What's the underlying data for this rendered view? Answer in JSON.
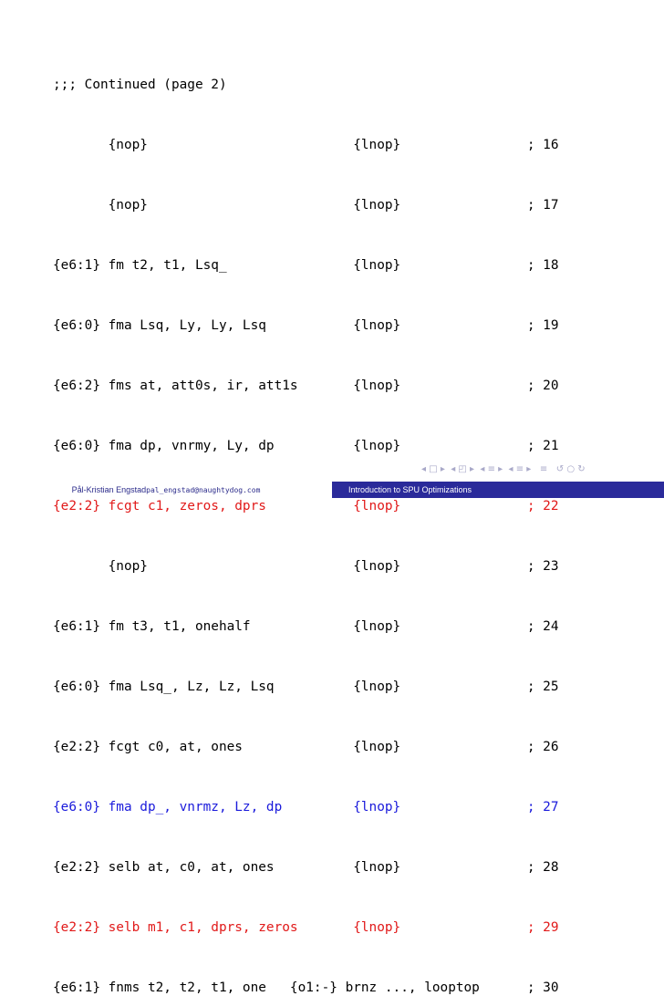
{
  "code_lines": [
    {
      "text": ";;; Continued (page 2)",
      "color": "black"
    },
    {
      "text": "       {nop}                          {lnop}                ; 16",
      "color": "black"
    },
    {
      "text": "       {nop}                          {lnop}                ; 17",
      "color": "black"
    },
    {
      "text": "{e6:1} fm t2, t1, Lsq_                {lnop}                ; 18",
      "color": "black"
    },
    {
      "text": "{e6:0} fma Lsq, Ly, Ly, Lsq           {lnop}                ; 19",
      "color": "black"
    },
    {
      "text": "{e6:2} fms at, att0s, ir, att1s       {lnop}                ; 20",
      "color": "black"
    },
    {
      "text": "{e6:0} fma dp, vnrmy, Ly, dp          {lnop}                ; 21",
      "color": "black"
    },
    {
      "text": "{e2:2} fcgt c1, zeros, dprs           {lnop}                ; 22",
      "color": "red"
    },
    {
      "text": "       {nop}                          {lnop}                ; 23",
      "color": "black"
    },
    {
      "text": "{e6:1} fm t3, t1, onehalf             {lnop}                ; 24",
      "color": "black"
    },
    {
      "text": "{e6:0} fma Lsq_, Lz, Lz, Lsq          {lnop}                ; 25",
      "color": "black"
    },
    {
      "text": "{e2:2} fcgt c0, at, ones              {lnop}                ; 26",
      "color": "black"
    },
    {
      "text": "{e6:0} fma dp_, vnrmz, Lz, dp         {lnop}                ; 27",
      "color": "blue"
    },
    {
      "text": "{e2:2} selb at, c0, at, ones          {lnop}                ; 28",
      "color": "black"
    },
    {
      "text": "{e2:2} selb m1, c1, dprs, zeros       {lnop}                ; 29",
      "color": "red"
    },
    {
      "text": "{e6:1} fnms t2, t2, t1, one   {o1:-} brnz ..., looptop      ; 30",
      "color": "black"
    }
  ],
  "footer": {
    "author": "Pål-Kristian Engstad",
    "email": "pal_engstad@naughtydog.com",
    "title": "Introduction to SPU Optimizations"
  },
  "colors": {
    "red": "#e11919",
    "blue": "#1a1adb",
    "footer_dark": "#2a2a9a",
    "footer_text": "#2a2a8a"
  },
  "navigation": {
    "icons": "◂ □ ▸  ◂ ◰ ▸  ◂ ≡ ▸  ◂ ≡ ▸   ≡   ↺ ○ ↻"
  }
}
